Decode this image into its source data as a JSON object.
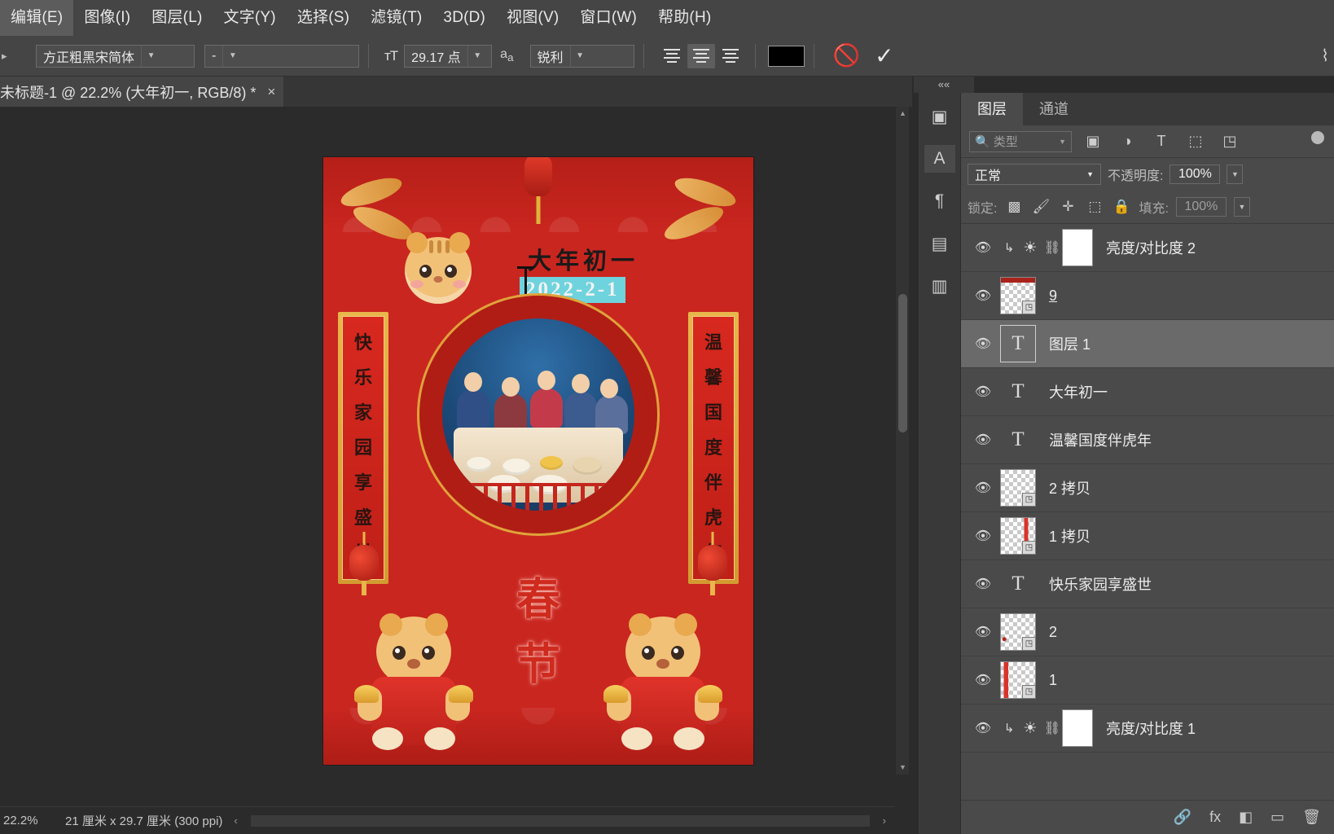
{
  "menubar": {
    "items": [
      {
        "label": "编辑(E)"
      },
      {
        "label": "图像(I)"
      },
      {
        "label": "图层(L)"
      },
      {
        "label": "文字(Y)"
      },
      {
        "label": "选择(S)"
      },
      {
        "label": "滤镜(T)"
      },
      {
        "label": "3D(D)"
      },
      {
        "label": "视图(V)"
      },
      {
        "label": "窗口(W)"
      },
      {
        "label": "帮助(H)"
      }
    ]
  },
  "options_bar": {
    "font_family": "方正粗黑宋简体",
    "font_style": "-",
    "size_icon": "font-size-icon",
    "font_size": "29.17 点",
    "aa_icon": "anti-alias-icon",
    "anti_alias": "锐利",
    "align_left": "align-left-icon",
    "align_center": "align-center-icon",
    "align_right": "align-right-icon",
    "text_color": "#000000",
    "cancel_icon": "cancel-edit-icon",
    "commit_icon": "commit-edit-icon"
  },
  "document_tab": {
    "title": "未标题-1 @ 22.2% (大年初一, RGB/8) *",
    "close": "×"
  },
  "canvas": {
    "headline": "大年初一",
    "selected_text": "2022-2-1",
    "selection_color": "#6fd3dd",
    "couplet_left": [
      "快",
      "乐",
      "家",
      "园",
      "享",
      "盛",
      "世"
    ],
    "couplet_right": [
      "温",
      "馨",
      "国",
      "度",
      "伴",
      "虎",
      "年"
    ],
    "festival_chars": [
      "春",
      "节"
    ],
    "background_color": "#c9261f"
  },
  "status_bar": {
    "zoom": "22.2%",
    "dimensions": "21 厘米 x 29.7 厘米 (300 ppi)",
    "left_arrow": "‹",
    "right_arrow": "›"
  },
  "dock": {
    "collapse_icon": "««",
    "rail_items": [
      {
        "name": "3d-panel-icon",
        "glyph": "▣"
      },
      {
        "name": "character-panel-icon",
        "glyph": "A"
      },
      {
        "name": "paragraph-panel-icon",
        "glyph": "¶"
      },
      {
        "name": "properties-panel-icon",
        "glyph": "▤"
      },
      {
        "name": "notes-panel-icon",
        "glyph": "▥"
      }
    ]
  },
  "layers_panel": {
    "tabs": [
      {
        "label": "图层",
        "active": true
      },
      {
        "label": "通道",
        "active": false
      }
    ],
    "filter": {
      "search_icon": "search-icon",
      "placeholder": "类型",
      "icons": [
        {
          "name": "filter-pixel-icon",
          "glyph": "▣"
        },
        {
          "name": "filter-adjustment-icon",
          "glyph": "◑"
        },
        {
          "name": "filter-type-icon",
          "glyph": "T"
        },
        {
          "name": "filter-shape-icon",
          "glyph": "⬚"
        },
        {
          "name": "filter-smartobject-icon",
          "glyph": "◳"
        }
      ],
      "toggle": "filter-enable-toggle"
    },
    "blend_mode": "正常",
    "opacity_label": "不透明度:",
    "opacity_value": "100%",
    "lock_label": "锁定:",
    "lock_icons": [
      {
        "name": "lock-transparency-icon",
        "glyph": "▩"
      },
      {
        "name": "lock-image-icon",
        "glyph": "🖌"
      },
      {
        "name": "lock-position-icon",
        "glyph": "✛"
      },
      {
        "name": "lock-artboard-icon",
        "glyph": "⬚"
      },
      {
        "name": "lock-all-icon",
        "glyph": "🔒"
      }
    ],
    "fill_label": "填充:",
    "fill_value": "100%",
    "layers": [
      {
        "name": "亮度/对比度 2",
        "kind": "adjustment",
        "visible": true,
        "clipped": true,
        "linked": true,
        "selected": false
      },
      {
        "name": "9",
        "kind": "smartobject",
        "visible": true,
        "clipped": false,
        "selected": false,
        "editing": true,
        "thumb": "red-top-strip"
      },
      {
        "name": "图层 1",
        "kind": "type",
        "visible": true,
        "clipped": false,
        "selected": true,
        "boxed": true
      },
      {
        "name": "大年初一",
        "kind": "type",
        "visible": true,
        "clipped": false,
        "selected": false
      },
      {
        "name": "温馨国度伴虎年",
        "kind": "type",
        "visible": true,
        "clipped": false,
        "selected": false
      },
      {
        "name": "2 拷贝",
        "kind": "smartobject",
        "visible": true,
        "clipped": false,
        "selected": false,
        "thumb": "faint"
      },
      {
        "name": "1 拷贝",
        "kind": "smartobject",
        "visible": true,
        "clipped": false,
        "selected": false,
        "thumb": "red-bar-right"
      },
      {
        "name": "快乐家园享盛世",
        "kind": "type",
        "visible": true,
        "clipped": false,
        "selected": false
      },
      {
        "name": "2",
        "kind": "smartobject",
        "visible": true,
        "clipped": false,
        "selected": false,
        "thumb": "dot"
      },
      {
        "name": "1",
        "kind": "smartobject",
        "visible": true,
        "clipped": false,
        "selected": false,
        "thumb": "red-bar-left"
      },
      {
        "name": "亮度/对比度 1",
        "kind": "adjustment",
        "visible": true,
        "clipped": true,
        "linked": true,
        "selected": false
      }
    ],
    "footer_icons": [
      {
        "name": "link-layers-icon",
        "glyph": "🔗"
      },
      {
        "name": "layer-style-icon",
        "glyph": "fx"
      },
      {
        "name": "layer-mask-icon",
        "glyph": "◧"
      },
      {
        "name": "new-group-icon",
        "glyph": "▭"
      },
      {
        "name": "delete-layer-icon",
        "glyph": "🗑"
      }
    ]
  }
}
